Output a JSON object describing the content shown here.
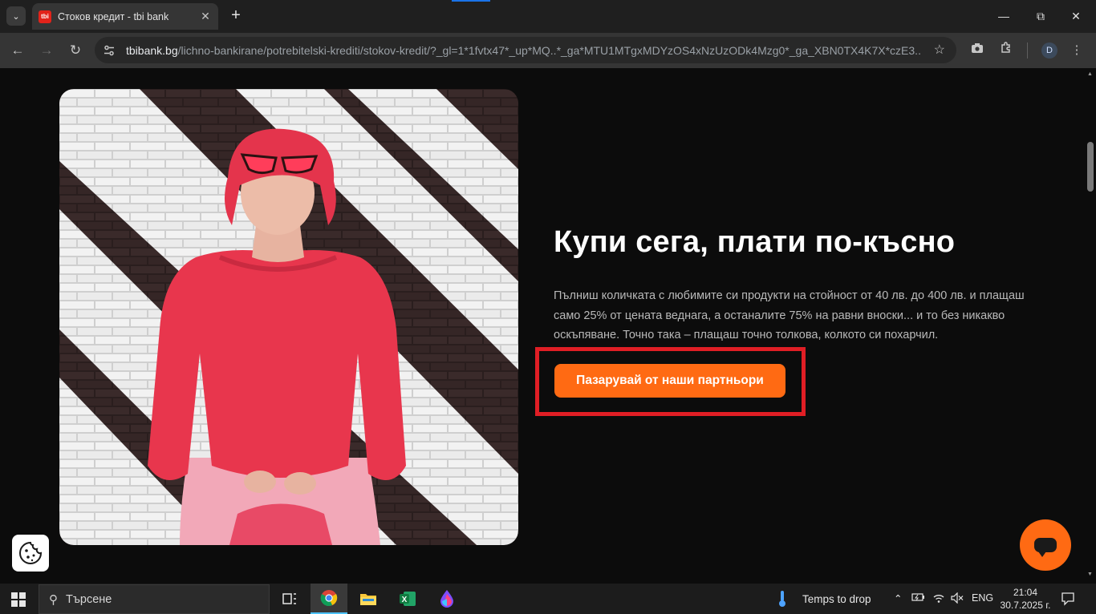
{
  "browser": {
    "tab_title": "Стоков кредит - tbi bank",
    "favicon_text": "tbi",
    "url_host": "tbibank.bg",
    "url_path": "/lichno-bankirane/potrebitelski-krediti/stokov-kredit/?_gl=1*1fvtx47*_up*MQ..*_ga*MTU1MTgxMDYzOS4xNzUzODk4Mzg0*_ga_XBN0TX4K7X*czE3...",
    "profile_initial": "D"
  },
  "hero": {
    "headline": "Купи сега, плати по-късно",
    "description": "Пълниш количката с любимите си продукти на стойност от 40 лв. до 400 лв. и плащаш само 25% от цената веднага, а останалите 75% на равни вноски... и то без никакво оскъпяване. Точно така – плащаш точно толкова, колкото си похарчил.",
    "cta_label": "Пазарувай от наши партньори"
  },
  "colors": {
    "accent": "#ff6a13",
    "highlight": "#e01e25",
    "background": "#0c0c0c"
  },
  "taskbar": {
    "search_placeholder": "Търсене",
    "weather_text": "Temps to drop",
    "language": "ENG",
    "time": "21:04",
    "date": "30.7.2025 г."
  }
}
